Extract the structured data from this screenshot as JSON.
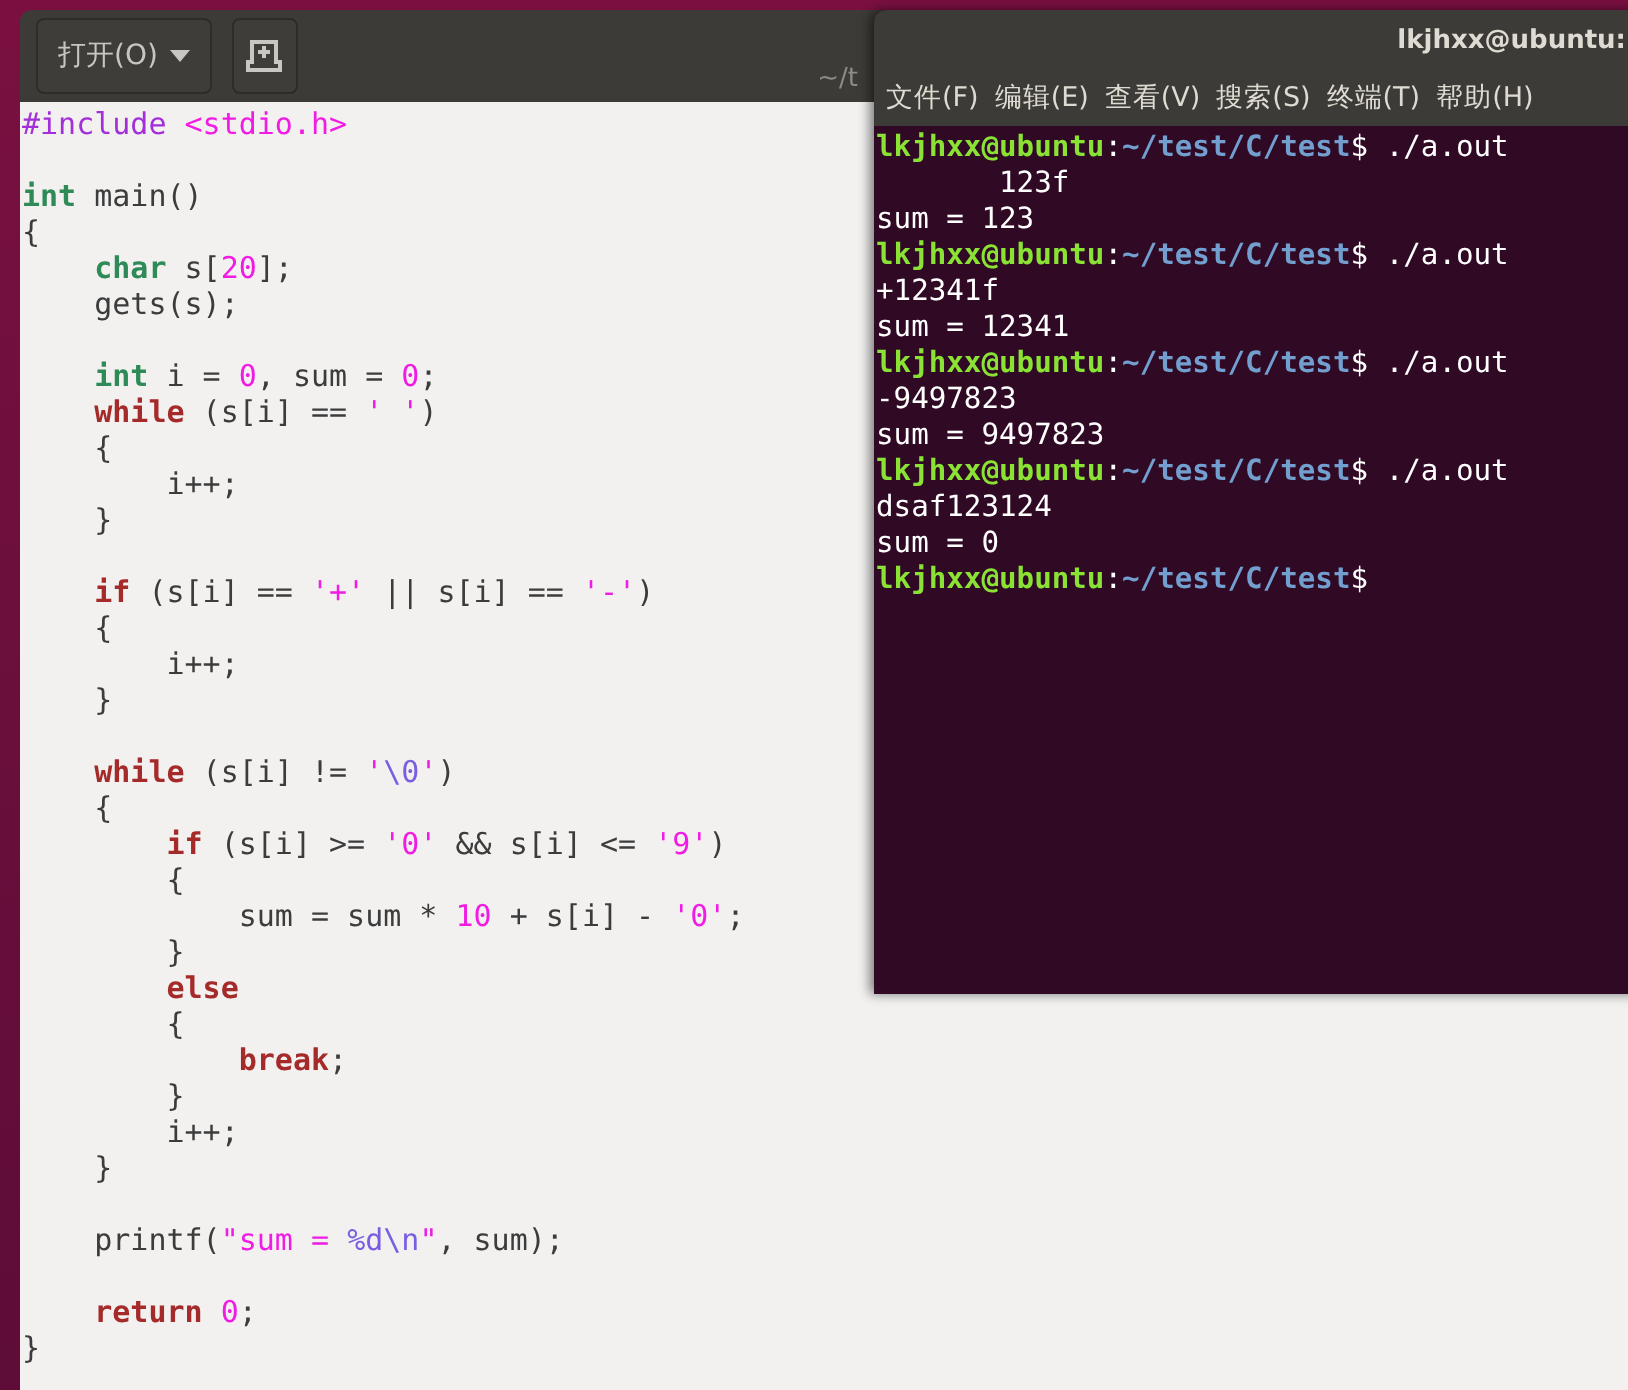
{
  "editor": {
    "open_button": {
      "label": "打开(O)"
    },
    "header_path": "~/t",
    "lines": [
      {
        "kind": "code",
        "tokens": [
          {
            "text": "#include ",
            "kind": "preproc"
          },
          {
            "text": "<stdio.h>",
            "kind": "string"
          }
        ]
      },
      {
        "kind": "blank"
      },
      {
        "kind": "code",
        "tokens": [
          {
            "text": "int",
            "kind": "type"
          },
          {
            "text": " main()",
            "kind": "plain"
          }
        ]
      },
      {
        "kind": "code",
        "tokens": [
          {
            "text": "{",
            "kind": "plain"
          }
        ]
      },
      {
        "kind": "code",
        "tokens": [
          {
            "text": "    char",
            "kind": "type"
          },
          {
            "text": " s[",
            "kind": "plain"
          },
          {
            "text": "20",
            "kind": "number"
          },
          {
            "text": "];",
            "kind": "plain"
          }
        ]
      },
      {
        "kind": "code",
        "tokens": [
          {
            "text": "    gets(s);",
            "kind": "plain"
          }
        ]
      },
      {
        "kind": "blank"
      },
      {
        "kind": "code",
        "tokens": [
          {
            "text": "    int",
            "kind": "type"
          },
          {
            "text": " i = ",
            "kind": "plain"
          },
          {
            "text": "0",
            "kind": "number"
          },
          {
            "text": ", sum = ",
            "kind": "plain"
          },
          {
            "text": "0",
            "kind": "number"
          },
          {
            "text": ";",
            "kind": "plain"
          }
        ]
      },
      {
        "kind": "code",
        "tokens": [
          {
            "text": "    while",
            "kind": "keyword"
          },
          {
            "text": " (s[i] == ",
            "kind": "plain"
          },
          {
            "text": "' '",
            "kind": "string"
          },
          {
            "text": ")",
            "kind": "plain"
          }
        ]
      },
      {
        "kind": "code",
        "tokens": [
          {
            "text": "    {",
            "kind": "plain"
          }
        ]
      },
      {
        "kind": "code",
        "tokens": [
          {
            "text": "        i++;",
            "kind": "plain"
          }
        ]
      },
      {
        "kind": "code",
        "tokens": [
          {
            "text": "    }",
            "kind": "plain"
          }
        ]
      },
      {
        "kind": "blank"
      },
      {
        "kind": "code",
        "tokens": [
          {
            "text": "    if",
            "kind": "keyword"
          },
          {
            "text": " (s[i] == ",
            "kind": "plain"
          },
          {
            "text": "'+'",
            "kind": "string"
          },
          {
            "text": " || s[i] == ",
            "kind": "plain"
          },
          {
            "text": "'-'",
            "kind": "string"
          },
          {
            "text": ")",
            "kind": "plain"
          }
        ]
      },
      {
        "kind": "code",
        "tokens": [
          {
            "text": "    {",
            "kind": "plain"
          }
        ]
      },
      {
        "kind": "code",
        "tokens": [
          {
            "text": "        i++;",
            "kind": "plain"
          }
        ]
      },
      {
        "kind": "code",
        "tokens": [
          {
            "text": "    }",
            "kind": "plain"
          }
        ]
      },
      {
        "kind": "blank"
      },
      {
        "kind": "code",
        "tokens": [
          {
            "text": "    while",
            "kind": "keyword"
          },
          {
            "text": " (s[i] != ",
            "kind": "plain"
          },
          {
            "text": "'",
            "kind": "string"
          },
          {
            "text": "\\0",
            "kind": "escape"
          },
          {
            "text": "'",
            "kind": "string"
          },
          {
            "text": ")",
            "kind": "plain"
          }
        ]
      },
      {
        "kind": "code",
        "tokens": [
          {
            "text": "    {",
            "kind": "plain"
          }
        ]
      },
      {
        "kind": "code",
        "tokens": [
          {
            "text": "        if",
            "kind": "keyword"
          },
          {
            "text": " (s[i] >= ",
            "kind": "plain"
          },
          {
            "text": "'0'",
            "kind": "string"
          },
          {
            "text": " && s[i] <= ",
            "kind": "plain"
          },
          {
            "text": "'9'",
            "kind": "string"
          },
          {
            "text": ")",
            "kind": "plain"
          }
        ]
      },
      {
        "kind": "code",
        "tokens": [
          {
            "text": "        {",
            "kind": "plain"
          }
        ]
      },
      {
        "kind": "code",
        "tokens": [
          {
            "text": "            sum = sum * ",
            "kind": "plain"
          },
          {
            "text": "10",
            "kind": "number"
          },
          {
            "text": " + s[i] - ",
            "kind": "plain"
          },
          {
            "text": "'0'",
            "kind": "string"
          },
          {
            "text": ";",
            "kind": "plain"
          }
        ]
      },
      {
        "kind": "code",
        "tokens": [
          {
            "text": "        }",
            "kind": "plain"
          }
        ]
      },
      {
        "kind": "code",
        "tokens": [
          {
            "text": "        else",
            "kind": "keyword"
          }
        ]
      },
      {
        "kind": "code",
        "tokens": [
          {
            "text": "        {",
            "kind": "plain"
          }
        ]
      },
      {
        "kind": "code",
        "tokens": [
          {
            "text": "            break",
            "kind": "keyword"
          },
          {
            "text": ";",
            "kind": "plain"
          }
        ]
      },
      {
        "kind": "code",
        "tokens": [
          {
            "text": "        }",
            "kind": "plain"
          }
        ]
      },
      {
        "kind": "code",
        "tokens": [
          {
            "text": "        i++;",
            "kind": "plain"
          }
        ]
      },
      {
        "kind": "code",
        "tokens": [
          {
            "text": "    }",
            "kind": "plain"
          }
        ]
      },
      {
        "kind": "blank"
      },
      {
        "kind": "code",
        "tokens": [
          {
            "text": "    printf(",
            "kind": "plain"
          },
          {
            "text": "\"sum = ",
            "kind": "string"
          },
          {
            "text": "%d\\n",
            "kind": "escape"
          },
          {
            "text": "\"",
            "kind": "string"
          },
          {
            "text": ", sum);",
            "kind": "plain"
          }
        ]
      },
      {
        "kind": "blank"
      },
      {
        "kind": "code",
        "tokens": [
          {
            "text": "    return",
            "kind": "keyword"
          },
          {
            "text": " 0",
            "kind": "number"
          },
          {
            "text": ";",
            "kind": "plain"
          }
        ]
      },
      {
        "kind": "code",
        "tokens": [
          {
            "text": "}",
            "kind": "plain"
          }
        ]
      }
    ]
  },
  "terminal": {
    "title": "lkjhxx@ubuntu:",
    "menu": [
      "文件(F)",
      "编辑(E)",
      "查看(V)",
      "搜索(S)",
      "终端(T)",
      "帮助(H)"
    ],
    "lines": [
      {
        "kind": "prompt",
        "user": "lkjhxx@ubuntu",
        "sep": ":",
        "path": "~/test/C/test",
        "command": "$ ./a.out"
      },
      {
        "kind": "output",
        "text": "       123f"
      },
      {
        "kind": "output",
        "text": "sum = 123"
      },
      {
        "kind": "prompt",
        "user": "lkjhxx@ubuntu",
        "sep": ":",
        "path": "~/test/C/test",
        "command": "$ ./a.out"
      },
      {
        "kind": "output",
        "text": "+12341f"
      },
      {
        "kind": "output",
        "text": "sum = 12341"
      },
      {
        "kind": "prompt",
        "user": "lkjhxx@ubuntu",
        "sep": ":",
        "path": "~/test/C/test",
        "command": "$ ./a.out"
      },
      {
        "kind": "output",
        "text": "-9497823"
      },
      {
        "kind": "output",
        "text": "sum = 9497823"
      },
      {
        "kind": "prompt",
        "user": "lkjhxx@ubuntu",
        "sep": ":",
        "path": "~/test/C/test",
        "command": "$ ./a.out"
      },
      {
        "kind": "output",
        "text": "dsaf123124"
      },
      {
        "kind": "output",
        "text": "sum = 0"
      },
      {
        "kind": "prompt",
        "user": "lkjhxx@ubuntu",
        "sep": ":",
        "path": "~/test/C/test",
        "command": "$"
      }
    ]
  }
}
